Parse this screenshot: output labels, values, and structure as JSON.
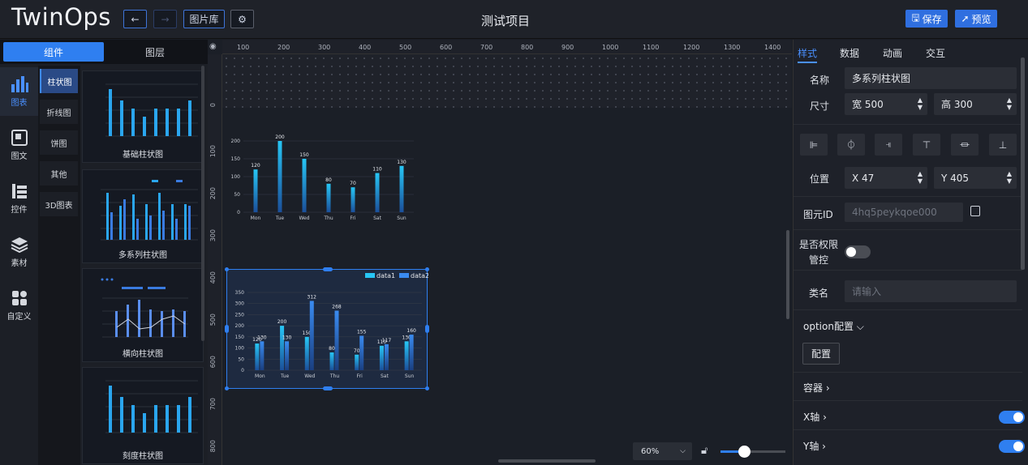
{
  "app": {
    "logo": "TwinOps",
    "title": "测试项目",
    "image_lib": "图片库",
    "save": "保存",
    "preview": "预览"
  },
  "left": {
    "tabs": [
      "组件",
      "图层"
    ],
    "rail": [
      {
        "label": "图表",
        "icon": "bar-chart-icon"
      },
      {
        "label": "图文",
        "icon": "image-text-icon"
      },
      {
        "label": "控件",
        "icon": "control-icon"
      },
      {
        "label": "素材",
        "icon": "layers-icon"
      },
      {
        "label": "自定义",
        "icon": "grid-icon"
      }
    ],
    "subnav": [
      "柱状图",
      "折线图",
      "饼图",
      "其他",
      "3D图表"
    ],
    "thumbs": [
      "基础柱状图",
      "多系列柱状图",
      "横向柱状图",
      "刻度柱状图"
    ]
  },
  "canvas": {
    "top_ticks": [
      "100",
      "200",
      "300",
      "400",
      "500",
      "600",
      "700",
      "800",
      "900",
      "1000",
      "1100",
      "1200",
      "1300",
      "1400"
    ],
    "left_ticks": [
      "0",
      "100",
      "200",
      "300",
      "400",
      "500",
      "600",
      "700",
      "800"
    ],
    "zoom": "60%"
  },
  "chart_data": [
    {
      "type": "bar",
      "categories": [
        "Mon",
        "Tue",
        "Wed",
        "Thu",
        "Fri",
        "Sat",
        "Sun"
      ],
      "values": [
        120,
        200,
        150,
        80,
        70,
        110,
        130
      ],
      "ylim": [
        0,
        200
      ],
      "yticks": [
        "0",
        "50",
        "100",
        "150",
        "200"
      ]
    },
    {
      "type": "bar",
      "categories": [
        "Mon",
        "Tue",
        "Wed",
        "Thu",
        "Fri",
        "Sat",
        "Sun"
      ],
      "series": [
        {
          "name": "data1",
          "values": [
            120,
            200,
            150,
            80,
            70,
            110,
            130
          ]
        },
        {
          "name": "data2",
          "values": [
            130,
            130,
            312,
            268,
            155,
            117,
            160
          ]
        }
      ],
      "ylim": [
        0,
        350
      ],
      "yticks": [
        "0",
        "50",
        "100",
        "150",
        "200",
        "250",
        "300",
        "350"
      ],
      "legend": "top-right"
    }
  ],
  "right": {
    "tabs": [
      "样式",
      "数据",
      "动画",
      "交互"
    ],
    "name_label": "名称",
    "name_value": "多系列柱状图",
    "size_label": "尺寸",
    "width": "宽 500",
    "height": "高 300",
    "pos_label": "位置",
    "x": "X 47",
    "y": "Y 405",
    "id_label": "图元ID",
    "id_value": "4hq5peykqoe000",
    "perm_label_1": "是否权限",
    "perm_label_2": "管控",
    "class_label": "类名",
    "class_placeholder": "请输入",
    "option_label": "option配置",
    "config_btn": "配置",
    "container": "容器",
    "xaxis": "X轴",
    "yaxis": "Y轴",
    "accent": "#2f7ff0"
  }
}
